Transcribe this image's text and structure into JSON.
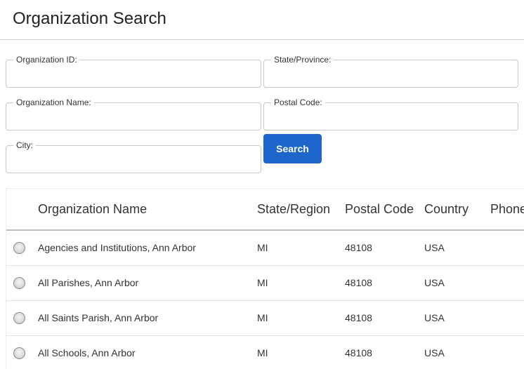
{
  "header": {
    "title": "Organization Search"
  },
  "form": {
    "organization_id": {
      "label": "Organization ID:",
      "value": ""
    },
    "state_province": {
      "label": "State/Province:",
      "value": ""
    },
    "organization_name": {
      "label": "Organization Name:",
      "value": ""
    },
    "postal_code": {
      "label": "Postal Code:",
      "value": ""
    },
    "city": {
      "label": "City:",
      "value": ""
    },
    "search_label": "Search"
  },
  "colors": {
    "accent": "#1f66cc"
  },
  "table": {
    "columns": [
      "Organization Name",
      "State/Region",
      "Postal Code",
      "Country",
      "Phone"
    ],
    "rows": [
      {
        "name": "Agencies and Institutions, Ann Arbor",
        "state": "MI",
        "postal": "48108",
        "country": "USA"
      },
      {
        "name": "All Parishes, Ann Arbor",
        "state": "MI",
        "postal": "48108",
        "country": "USA"
      },
      {
        "name": "All Saints Parish, Ann Arbor",
        "state": "MI",
        "postal": "48108",
        "country": "USA"
      },
      {
        "name": "All Schools, Ann Arbor",
        "state": "MI",
        "postal": "48108",
        "country": "USA"
      }
    ]
  }
}
